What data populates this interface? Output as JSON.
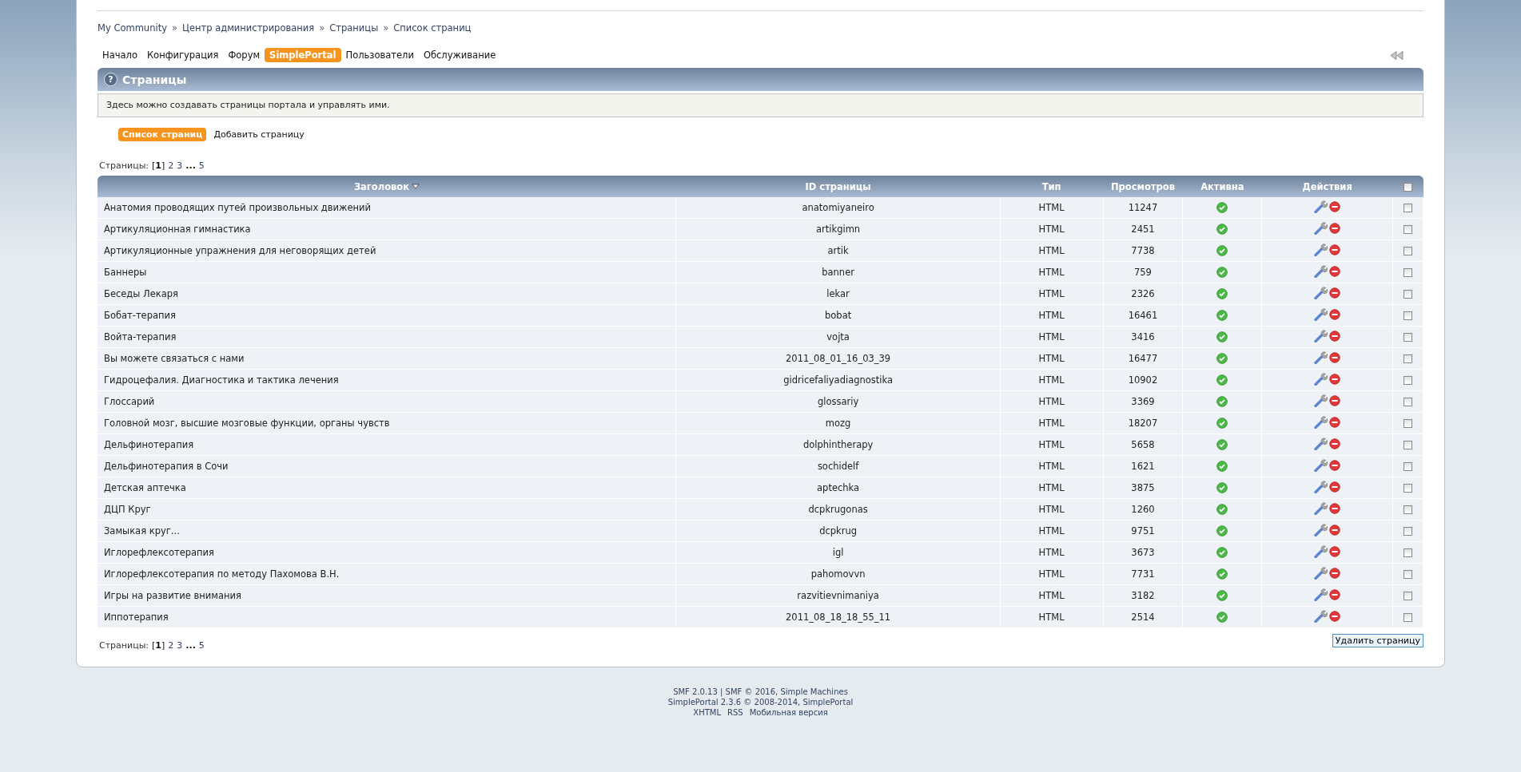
{
  "breadcrumb": [
    "My Community",
    "Центр администрирования",
    "Страницы",
    "Список страниц"
  ],
  "breadcrumb_separator": "»",
  "menu": [
    {
      "label": "Начало",
      "selected": false
    },
    {
      "label": "Конфигурация",
      "selected": false
    },
    {
      "label": "Форум",
      "selected": false
    },
    {
      "label": "SimplePortal",
      "selected": true
    },
    {
      "label": "Пользователи",
      "selected": false
    },
    {
      "label": "Обслуживание",
      "selected": false
    }
  ],
  "section": {
    "help": "?",
    "title": "Страницы",
    "description": "Здесь можно создавать страницы портала и управлять ими."
  },
  "subtabs": [
    {
      "label": "Список страниц",
      "selected": true
    },
    {
      "label": "Добавить страницу",
      "selected": false
    }
  ],
  "pagination_top": {
    "label": "Страницы:",
    "pages": [
      {
        "kind": "current",
        "label": "[**1**]"
      },
      {
        "kind": "link",
        "label": "2"
      },
      {
        "kind": "link",
        "label": "3"
      },
      {
        "kind": "gap",
        "label": "..."
      },
      {
        "kind": "link",
        "label": "5"
      }
    ]
  },
  "table": {
    "columns": [
      "Заголовок",
      "ID страницы",
      "Тип",
      "Просмотров",
      "Активна",
      "Действия"
    ],
    "select_all_checked": false,
    "rows": [
      {
        "title": "Анатомия проводящих путей произвольных движений",
        "page_id": "anatomiyaneiro",
        "type": "HTML",
        "views": "11247",
        "active": true,
        "checked": false
      },
      {
        "title": "Артикуляционная гимнастика",
        "page_id": "artikgimn",
        "type": "HTML",
        "views": "2451",
        "active": true,
        "checked": false
      },
      {
        "title": "Артикуляционные упражнения для неговорящих детей",
        "page_id": "artik",
        "type": "HTML",
        "views": "7738",
        "active": true,
        "checked": false
      },
      {
        "title": "Баннеры",
        "page_id": "banner",
        "type": "HTML",
        "views": "759",
        "active": true,
        "checked": false
      },
      {
        "title": "Беседы Лекаря",
        "page_id": "lekar",
        "type": "HTML",
        "views": "2326",
        "active": true,
        "checked": false
      },
      {
        "title": "Бобат-терапия",
        "page_id": "bobat",
        "type": "HTML",
        "views": "16461",
        "active": true,
        "checked": false
      },
      {
        "title": "Войта-терапия",
        "page_id": "vojta",
        "type": "HTML",
        "views": "3416",
        "active": true,
        "checked": false
      },
      {
        "title": "Вы можете связаться с нами",
        "page_id": "2011_08_01_16_03_39",
        "type": "HTML",
        "views": "16477",
        "active": true,
        "checked": false
      },
      {
        "title": "Гидроцефалия. Диагностика и тактика лечения",
        "page_id": "gidricefaliyadiagnostika",
        "type": "HTML",
        "views": "10902",
        "active": true,
        "checked": false
      },
      {
        "title": "Глоссарий",
        "page_id": "glossariy",
        "type": "HTML",
        "views": "3369",
        "active": true,
        "checked": false
      },
      {
        "title": "Головной мозг, высшие мозговые функции, органы чувств",
        "page_id": "mozg",
        "type": "HTML",
        "views": "18207",
        "active": true,
        "checked": false
      },
      {
        "title": "Дельфинотерапия",
        "page_id": "dolphintherapy",
        "type": "HTML",
        "views": "5658",
        "active": true,
        "checked": false
      },
      {
        "title": "Дельфинотерапия в Сочи",
        "page_id": "sochidelf",
        "type": "HTML",
        "views": "1621",
        "active": true,
        "checked": false
      },
      {
        "title": "Детская аптечка",
        "page_id": "aptechka",
        "type": "HTML",
        "views": "3875",
        "active": true,
        "checked": false
      },
      {
        "title": "ДЦП Круг",
        "page_id": "dcpkrugonas",
        "type": "HTML",
        "views": "1260",
        "active": true,
        "checked": false
      },
      {
        "title": "Замыкая круг...",
        "page_id": "dcpkrug",
        "type": "HTML",
        "views": "9751",
        "active": true,
        "checked": false
      },
      {
        "title": "Иглорефлексотерапия",
        "page_id": "igl",
        "type": "HTML",
        "views": "3673",
        "active": true,
        "checked": false
      },
      {
        "title": "Иглорефлексотерапия по методу Пахомова В.Н.",
        "page_id": "pahomovvn",
        "type": "HTML",
        "views": "7731",
        "active": true,
        "checked": false
      },
      {
        "title": "Игры на развитие внимания",
        "page_id": "razvitievnimaniya",
        "type": "HTML",
        "views": "3182",
        "active": true,
        "checked": false
      },
      {
        "title": "Иппотерапия",
        "page_id": "2011_08_18_18_55_11",
        "type": "HTML",
        "views": "2514",
        "active": true,
        "checked": false
      }
    ]
  },
  "pagination_bottom": {
    "label": "Страницы:",
    "pages": [
      {
        "kind": "current",
        "label": "[**1**]"
      },
      {
        "kind": "link",
        "label": "2"
      },
      {
        "kind": "link",
        "label": "3"
      },
      {
        "kind": "gap",
        "label": "..."
      },
      {
        "kind": "link",
        "label": "5"
      }
    ]
  },
  "delete_button": "Удалить страницу",
  "footer": {
    "lines": [
      "SMF 2.0.13 | SMF © 2016, Simple Machines",
      "SimplePortal 2.3.6 © 2008-2014, SimplePortal"
    ],
    "links": [
      "XHTML",
      "RSS",
      "Мобильная версия"
    ]
  }
}
